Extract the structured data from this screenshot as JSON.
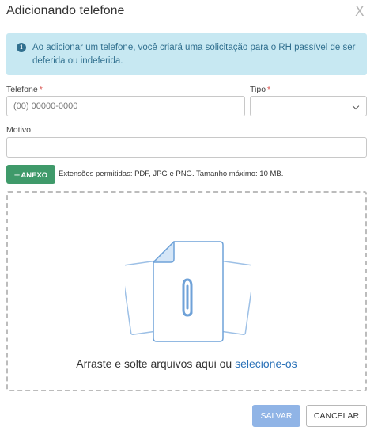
{
  "modal": {
    "title": "Adicionando telefone",
    "close_label": "X"
  },
  "alert": {
    "icon": "info-icon",
    "text": "Ao adicionar um telefone, você criará uma solicitação para o RH passível de ser deferida ou indeferida."
  },
  "form": {
    "phone": {
      "label": "Telefone",
      "required_mark": "*",
      "placeholder": "(00) 00000-0000",
      "value": ""
    },
    "type": {
      "label": "Tipo",
      "required_mark": "*",
      "selected": ""
    },
    "reason": {
      "label": "Motivo",
      "value": ""
    }
  },
  "attachments": {
    "button_icon": "+",
    "button_label": "ANEXO",
    "extensions_text": "Extensões permitidas: PDF, JPG e PNG. Tamanho máximo: 10 MB.",
    "dropzone_text": "Arraste e solte arquivos aqui ou",
    "dropzone_link": "selecione-os"
  },
  "actions": {
    "save_label": "SALVAR",
    "cancel_label": "CANCELAR"
  },
  "colors": {
    "alert_bg": "#c7e8f2",
    "alert_text": "#31708f",
    "attach_button": "#3f9a6a",
    "save_button": "#90b4e6",
    "link": "#2b72b8",
    "required": "#d9534f"
  }
}
